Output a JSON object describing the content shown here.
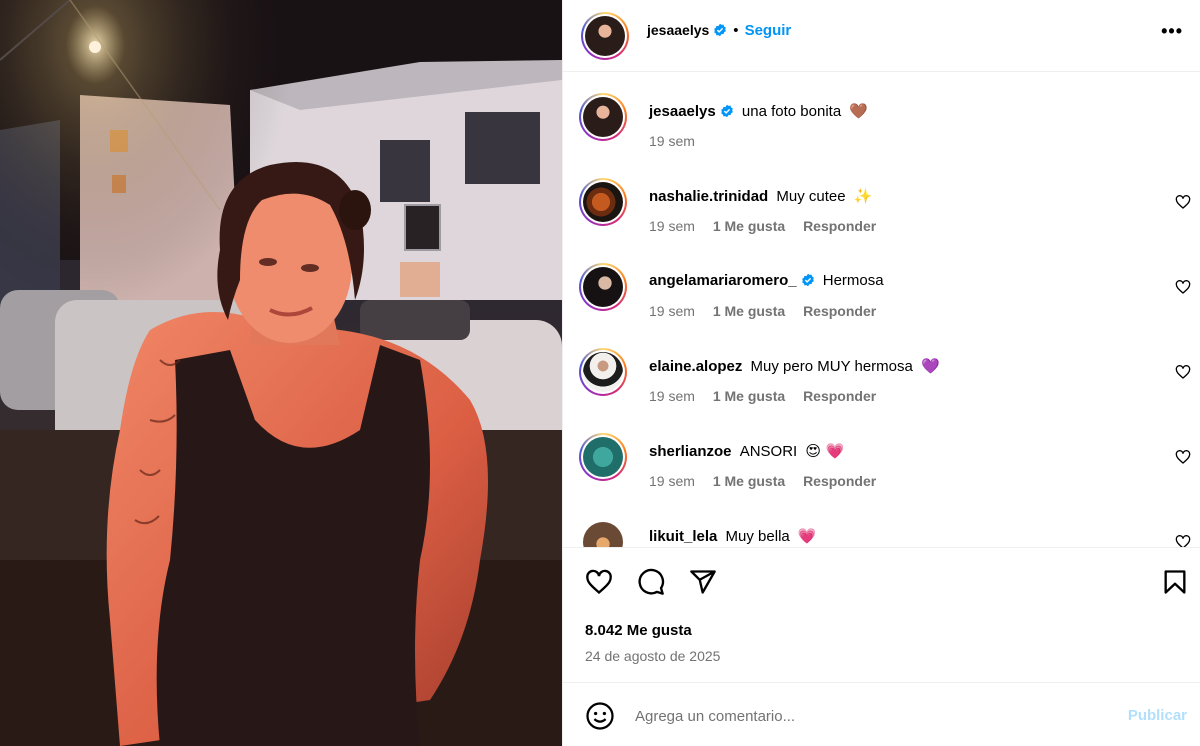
{
  "post": {
    "author": "jesaaelys",
    "verified": true,
    "follow_label": "Seguir",
    "more_label": "•••",
    "caption": "una foto bonita",
    "caption_emoji": "🤎",
    "caption_time": "19 sem",
    "likes_label": "8.042 Me gusta",
    "date_label": "24 de agosto de 2025"
  },
  "comments": [
    {
      "user": "nashalie.trinidad",
      "verified": false,
      "text": "Muy cutee",
      "emoji": "✨",
      "time": "19 sem",
      "likes": "1 Me gusta",
      "reply": "Responder"
    },
    {
      "user": "angelamariaromero_",
      "verified": true,
      "text": "Hermosa",
      "emoji": "",
      "time": "19 sem",
      "likes": "1 Me gusta",
      "reply": "Responder"
    },
    {
      "user": "elaine.alopez",
      "verified": false,
      "text": "Muy pero MUY hermosa",
      "emoji": "💜",
      "time": "19 sem",
      "likes": "1 Me gusta",
      "reply": "Responder"
    },
    {
      "user": "sherlianzoe",
      "verified": false,
      "text": "ANSORI",
      "emoji": "😍 💗",
      "time": "19 sem",
      "likes": "1 Me gusta",
      "reply": "Responder"
    },
    {
      "user": "likuit_lela",
      "verified": false,
      "text": "Muy bella",
      "emoji": "💗",
      "time": "",
      "likes": "",
      "reply": ""
    }
  ],
  "add_comment": {
    "placeholder": "Agrega un comentario...",
    "publish_label": "Publicar"
  },
  "icons": {
    "like": "heart-icon",
    "comment": "comment-icon",
    "share": "share-icon",
    "save": "bookmark-icon",
    "emoji": "smiley-icon",
    "verified": "verified-badge-icon"
  },
  "colors": {
    "accent": "#0095f6",
    "verified": "#0095f6",
    "muted": "#737373",
    "publish_disabled": "#b2dffc"
  }
}
